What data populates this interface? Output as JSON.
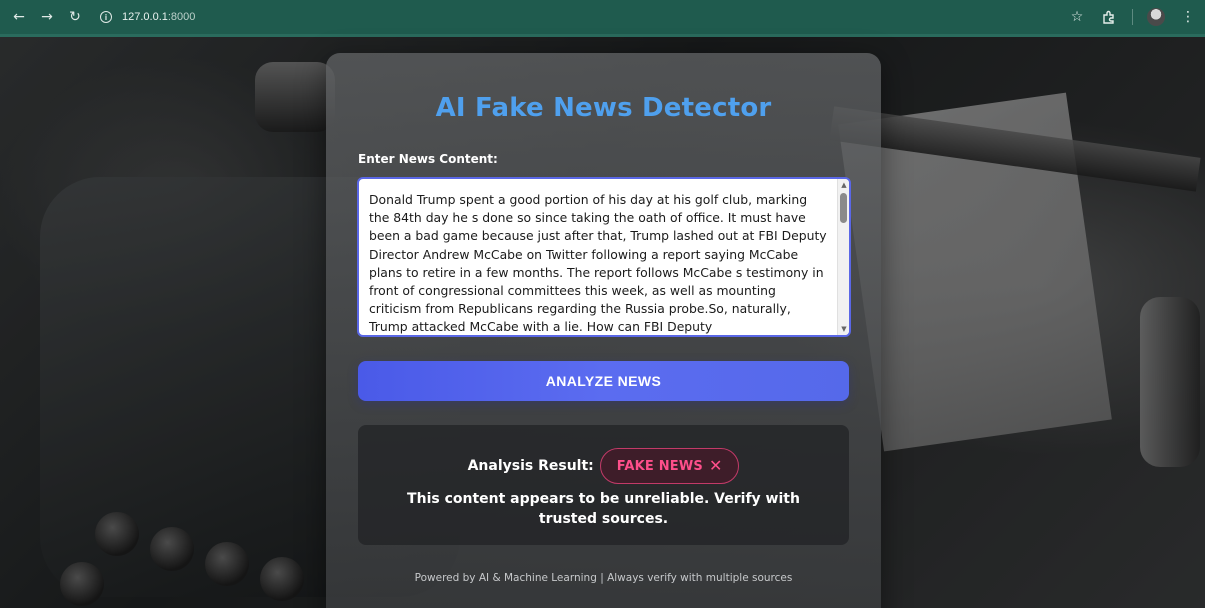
{
  "browser": {
    "url_host": "127.0.0.1",
    "url_port": ":8000",
    "back_icon": "back-arrow-icon",
    "forward_icon": "forward-arrow-icon",
    "reload_icon": "reload-icon",
    "info_icon": "info-icon",
    "right_icons": [
      "star-icon",
      "extensions-icon",
      "profile-avatar-icon",
      "menu-icon"
    ]
  },
  "app": {
    "title": "AI Fake News Detector",
    "field_label": "Enter News Content:",
    "textarea_value": "Donald Trump spent a good portion of his day at his golf club, marking the 84th day he s done so since taking the oath of office. It must have been a bad game because just after that, Trump lashed out at FBI Deputy Director Andrew McCabe on Twitter following a report saying McCabe plans to retire in a few months. The report follows McCabe s testimony in front of congressional committees this week, as well as mounting criticism from Republicans regarding the Russia probe.So, naturally, Trump attacked McCabe with a lie. How can FBI Deputy",
    "analyze_button": "ANALYZE NEWS",
    "result": {
      "label": "Analysis Result:",
      "badge_text": "FAKE NEWS",
      "badge_icon": "close-x-icon",
      "message": "This content appears to be unreliable. Verify with trusted sources."
    },
    "footer": "Powered by AI & Machine Learning | Always verify with multiple sources"
  },
  "colors": {
    "browser_bar": "#1f5b4e",
    "title": "#4fa0ee",
    "button": "#4a5ae8",
    "fake_badge": "#ff4f8b"
  }
}
